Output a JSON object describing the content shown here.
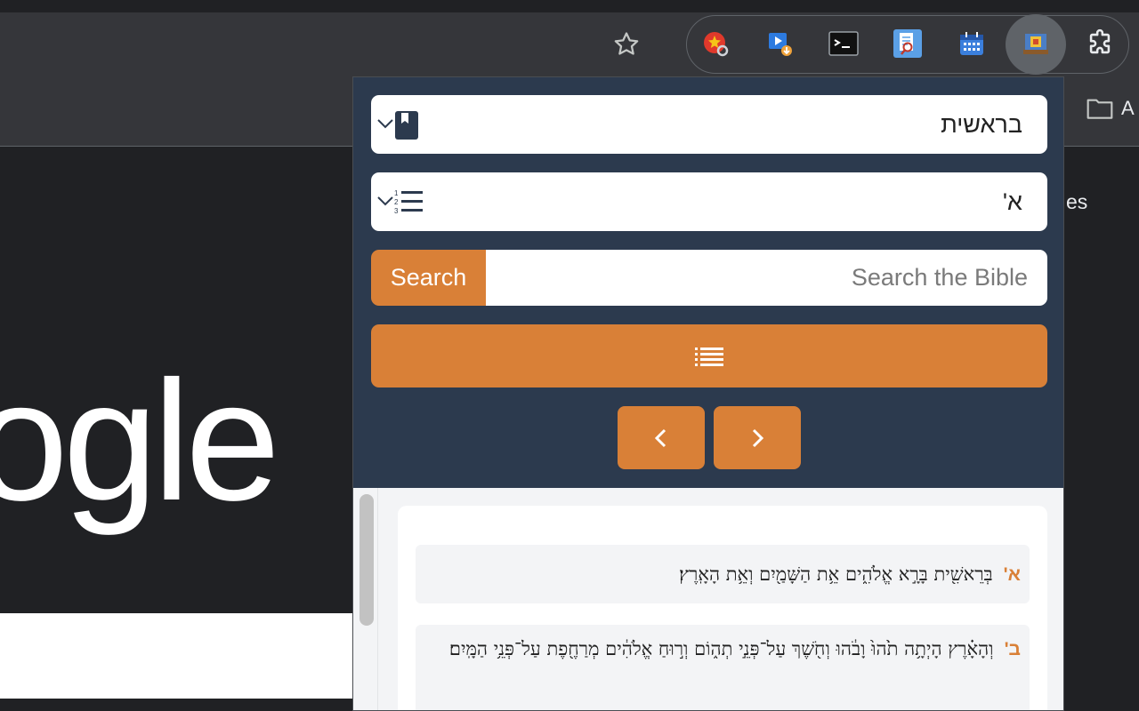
{
  "browser": {
    "bookmark_folder_label": "A",
    "bg_text_fragment": "es",
    "google_logo_fragment": "ogle",
    "extensions": [
      {
        "icon": "star-search-icon"
      },
      {
        "icon": "video-download-icon"
      },
      {
        "icon": "terminal-icon"
      },
      {
        "icon": "document-search-icon"
      },
      {
        "icon": "calendar-icon"
      },
      {
        "icon": "bible-app-icon"
      },
      {
        "icon": "puzzle-icon"
      }
    ]
  },
  "popup": {
    "book_select": {
      "value": "בראשית",
      "icon": "book-icon"
    },
    "chapter_select": {
      "value": "א'",
      "icon": "numbered-list-icon"
    },
    "search": {
      "button_label": "Search",
      "placeholder": "Search the Bible"
    },
    "toc_button": {
      "icon": "list-icon"
    },
    "prev_button": {
      "icon": "chevron-left-icon"
    },
    "next_button": {
      "icon": "chevron-right-icon"
    },
    "verses": [
      {
        "number": "א'",
        "text": "בְּרֵאשִׁ֖ית בָּרָ֣א אֱלֹהִ֑ים אֵ֥ת הַשָּׁמַ֖יִם וְאֵ֥ת הָאָֽרֶץ׃"
      },
      {
        "number": "ב'",
        "text": "וְהָאָ֗רֶץ הָיְתָ֥ה תֹ֙הוּ֙ וָבֹ֔הוּ וְחֹ֖שֶׁךְ עַל־פְּנֵ֣י תְה֑וֹם וְר֣וּחַ אֱלֹהִ֔ים מְרַחֶ֖פֶת עַל־פְּנֵ֥י הַמָּֽיִם׃"
      }
    ]
  },
  "colors": {
    "accent": "#d98037",
    "header": "#2c3a4e"
  }
}
